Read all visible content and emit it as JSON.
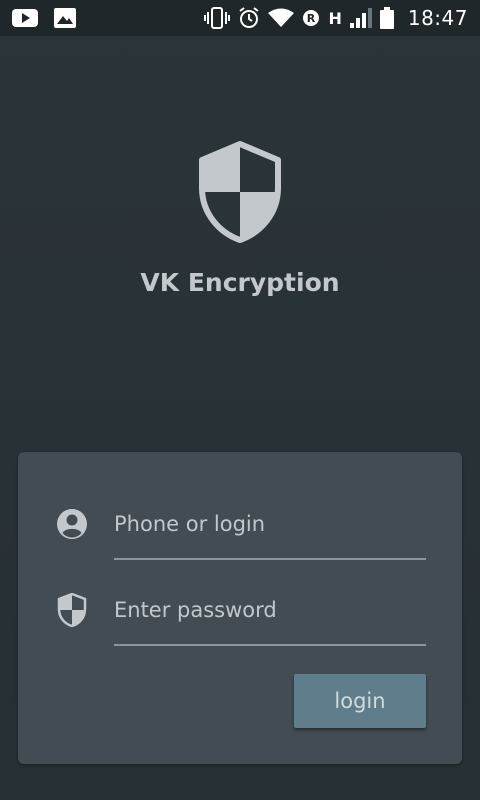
{
  "status_bar": {
    "time": "18:47",
    "network_letter": "H",
    "icons": [
      "youtube-icon",
      "image-icon",
      "vibrate-icon",
      "alarm-icon",
      "wifi-icon",
      "roaming-icon",
      "signal-icon",
      "battery-icon"
    ]
  },
  "app": {
    "title": "VK Encryption",
    "logo_icon": "shield-icon"
  },
  "form": {
    "phone_placeholder": "Phone or login",
    "phone_value": "",
    "password_placeholder": "Enter password",
    "password_value": "",
    "login_label": "login"
  },
  "colors": {
    "background": "#273035",
    "card": "#434c52",
    "button": "#607d8b",
    "shield": "#c3c8cc"
  }
}
